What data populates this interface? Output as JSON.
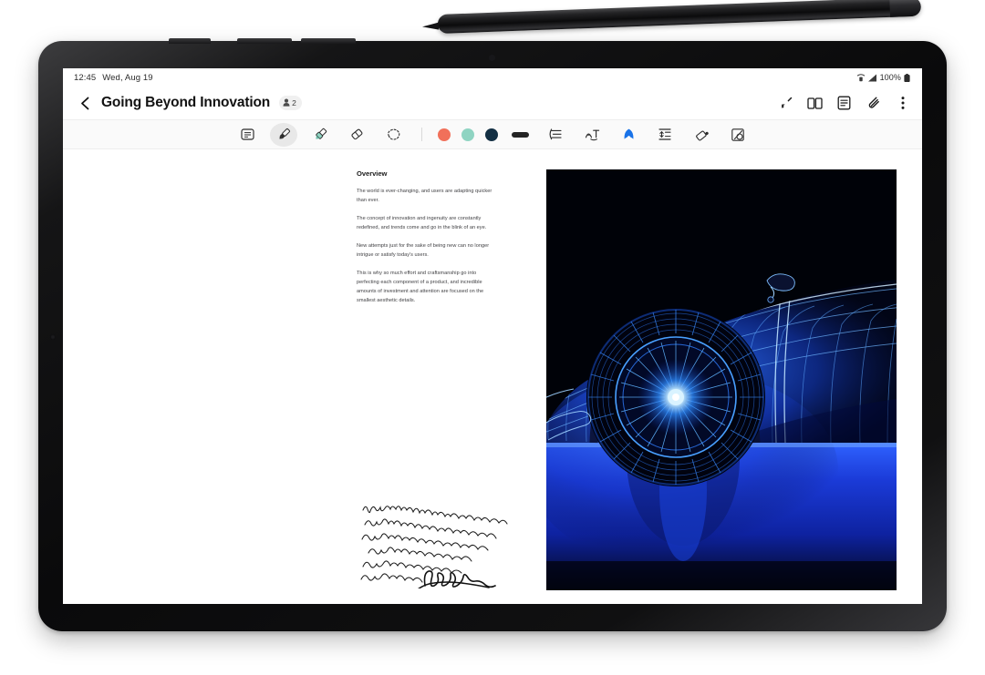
{
  "device": {
    "name": "samsung-galaxy-tab-with-s-pen",
    "stylus": "s-pen"
  },
  "status_bar": {
    "time": "12:45",
    "date": "Wed, Aug 19",
    "battery_percent": "100%",
    "icons": [
      "wifi-calling-icon",
      "signal-bars-icon",
      "battery-icon"
    ]
  },
  "header": {
    "back_label": "‹",
    "title": "Going Beyond Innovation",
    "collaborators_count": "2",
    "collaborator_icon": "person-icon",
    "actions": [
      {
        "name": "pen-cursor-icon",
        "label": ""
      },
      {
        "name": "book-view-icon",
        "label": ""
      },
      {
        "name": "note-list-icon",
        "label": ""
      },
      {
        "name": "attachment-icon",
        "label": ""
      },
      {
        "name": "more-options-icon",
        "label": "⋮"
      }
    ]
  },
  "pen_toolbar": {
    "tools": [
      {
        "name": "text-box-tool",
        "label": "text box",
        "selected": false
      },
      {
        "name": "pen-tool",
        "label": "pen",
        "selected": true
      },
      {
        "name": "highlighter-tool",
        "label": "highlighter",
        "selected": false
      },
      {
        "name": "eraser-tool",
        "label": "eraser",
        "selected": false
      },
      {
        "name": "lasso-select-tool",
        "label": "lasso select",
        "selected": false
      }
    ],
    "colors": [
      {
        "name": "color-coral",
        "hex": "#F1705A"
      },
      {
        "name": "color-mint",
        "hex": "#8FD4C2"
      },
      {
        "name": "color-navy",
        "hex": "#132F43"
      }
    ],
    "stroke_chip_color": "#242424",
    "extras": [
      {
        "name": "straighten-lines-tool",
        "label": "straighten"
      },
      {
        "name": "text-convert-tool",
        "label": "convert to text"
      },
      {
        "name": "shape-recognition-tool",
        "label": "shape recognition",
        "accent": "#1A73E8"
      },
      {
        "name": "align-spacing-tool",
        "label": "align spacing"
      },
      {
        "name": "fill-color-tool",
        "label": "fill color"
      },
      {
        "name": "smart-select-tool",
        "label": "smart select"
      }
    ]
  },
  "document": {
    "section_title": "Overview",
    "paragraphs": [
      "The world is ever-changing, and users are adapting quicker than ever.",
      "The concept of innovation and ingenuity are constantly redefined, and trends come and go in the blink of an eye.",
      "New attempts just for the sake of being new can no longer intrigue or satisfy today's users.",
      "This is why so much effort and craftsmanship go into perfecting each component of a product, and incredible amounts of investment and attention are focused on the smallest aesthetic details."
    ],
    "handwriting_note": "handwritten cursive annotation with signature",
    "image": {
      "name": "blue-wireframe-sports-car",
      "description": "3D blue wireframe render of a sports car front on black background with reflection",
      "colors": {
        "background": "#000000",
        "wire": "#2f7dff",
        "glow": "#9fd8ff",
        "reflection": "#1436c8"
      }
    }
  }
}
